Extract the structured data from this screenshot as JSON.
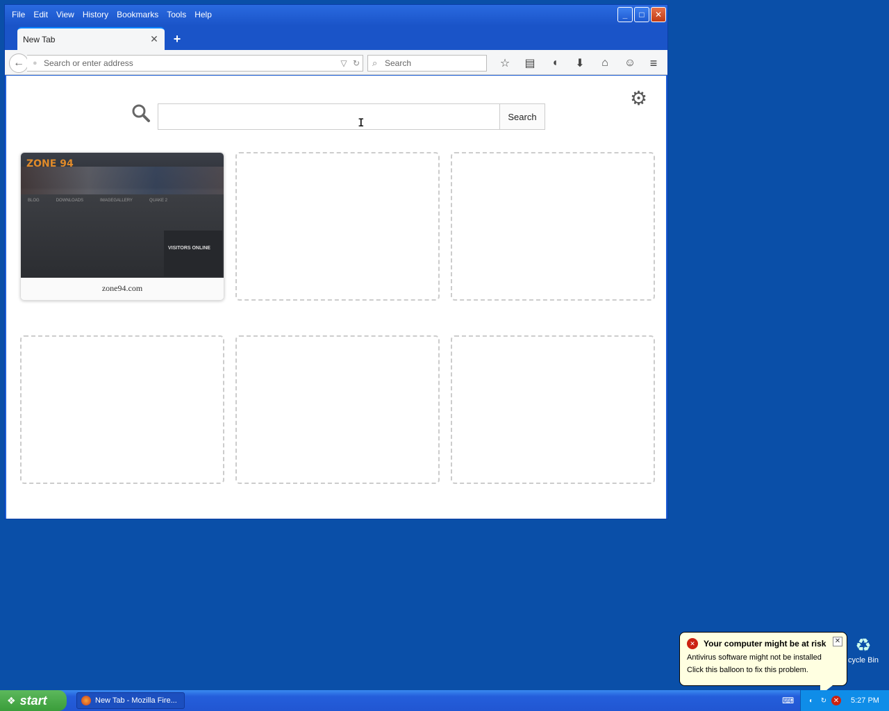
{
  "window": {
    "menu": [
      "File",
      "Edit",
      "View",
      "History",
      "Bookmarks",
      "Tools",
      "Help"
    ],
    "menu_accel": [
      "F",
      "E",
      "V",
      "H",
      "B",
      "T",
      "H"
    ],
    "controls": {
      "minimize": "_",
      "maximize": "□",
      "close": "✕"
    }
  },
  "tabs": [
    {
      "label": "New Tab",
      "close": "✕"
    }
  ],
  "newtab_symbol": "+",
  "navbar": {
    "back_symbol": "←",
    "url_placeholder": "Search or enter address",
    "url_value": "",
    "search_placeholder": "Search",
    "search_value": "",
    "icons": [
      "bookmark-star-icon",
      "reading-list-icon",
      "pocket-icon",
      "download-icon",
      "home-icon",
      "chat-icon"
    ],
    "icon_glyphs": [
      "☆",
      "▤",
      "◖",
      "⬇",
      "⌂",
      "☺"
    ],
    "menu_glyph": "≡"
  },
  "newtab": {
    "search_value": "",
    "search_button": "Search",
    "gear_glyph": "⚙",
    "mag_glyph": "🔍",
    "tiles": [
      {
        "filled": true,
        "label": "zone94.com",
        "thumb_title": "ZONE 94",
        "thumb_nav": [
          "BLOG",
          "DOWNLOADS",
          "IMAGEGALLERY",
          "QUAKE 2"
        ],
        "thumb_visitors": "VISITORS ONLINE"
      },
      {
        "filled": false
      },
      {
        "filled": false
      },
      {
        "filled": false
      },
      {
        "filled": false
      },
      {
        "filled": false
      }
    ]
  },
  "balloon": {
    "title": "Your computer might be at risk",
    "line1": "Antivirus software might not be installed",
    "line2": "Click this balloon to fix this problem.",
    "close": "✕"
  },
  "desktop": {
    "recycle_label": "cycle Bin"
  },
  "taskbar": {
    "start_label": "start",
    "task_label": "New Tab - Mozilla Fire...",
    "clock": "5:27 PM"
  }
}
